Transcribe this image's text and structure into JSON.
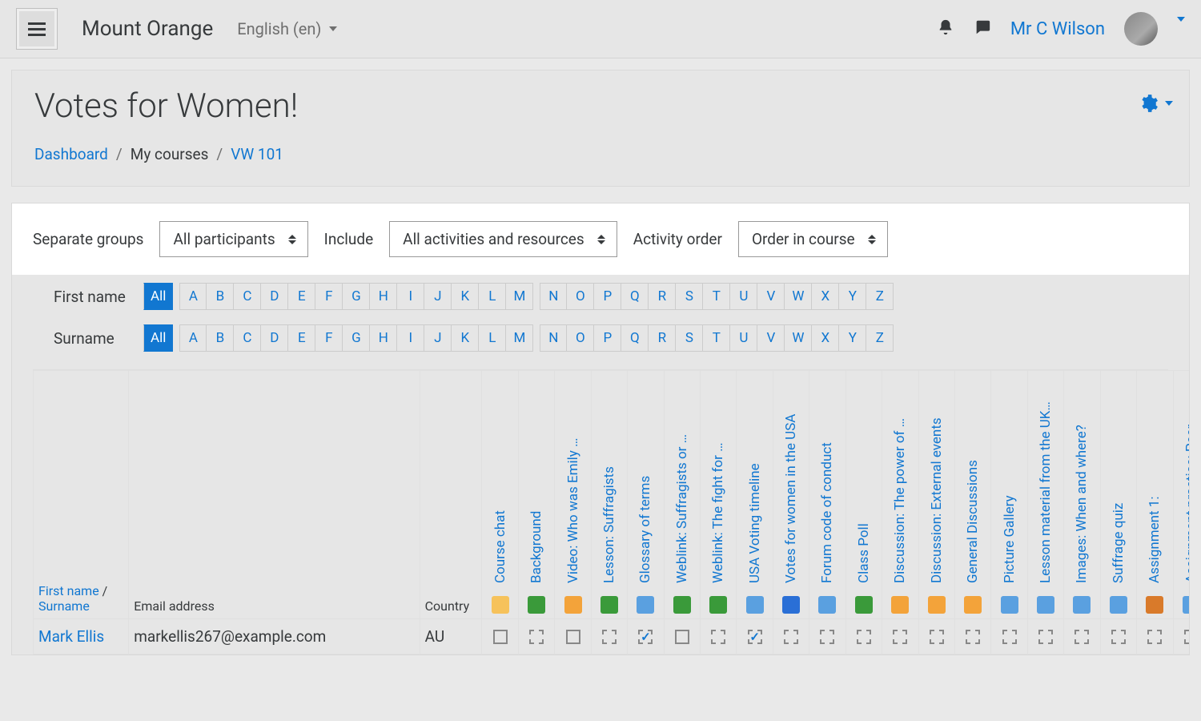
{
  "navbar": {
    "brand": "Mount Orange",
    "language": "English (en)",
    "user_name": "Mr C Wilson"
  },
  "header": {
    "title": "Votes for Women!",
    "breadcrumb": {
      "dashboard": "Dashboard",
      "mycourses": "My courses",
      "course_short": "VW 101"
    }
  },
  "filters": {
    "groups_label": "Separate groups",
    "groups_value": "All participants",
    "include_label": "Include",
    "include_value": "All activities and resources",
    "order_label": "Activity order",
    "order_value": "Order in course"
  },
  "letter_filter": {
    "firstname_label": "First name",
    "surname_label": "Surname",
    "all": "All",
    "letters": [
      "A",
      "B",
      "C",
      "D",
      "E",
      "F",
      "G",
      "H",
      "I",
      "J",
      "K",
      "L",
      "M",
      "N",
      "O",
      "P",
      "Q",
      "R",
      "S",
      "T",
      "U",
      "V",
      "W",
      "X",
      "Y",
      "Z"
    ]
  },
  "table": {
    "name_header_first": "First name",
    "name_header_surname": "Surname",
    "email_header": "Email address",
    "country_header": "Country",
    "activities": [
      "Course chat",
      "Background",
      "Video: Who was Emily …",
      "Lesson: Suffragists",
      "Glossary of terms",
      "Weblink: Suffragists or …",
      "Weblink: The fight for …",
      "USA Voting timeline",
      "Votes for women in the USA",
      "Forum code of conduct",
      "Class Poll",
      "Discussion: The power of …",
      "Discussion: External events",
      "General Discussions",
      "Picture Gallery",
      "Lesson material from the UK…",
      "Images: When and where?",
      "Suffrage quiz",
      "Assignment 1:",
      "Assignment practice: Peer …"
    ],
    "row": {
      "name": "Mark Ellis",
      "email": "markellis267@example.com",
      "country": "AU",
      "completion": [
        {
          "t": "solid"
        },
        {
          "t": "dash"
        },
        {
          "t": "solid"
        },
        {
          "t": "dash"
        },
        {
          "t": "dash",
          "done": true
        },
        {
          "t": "solid"
        },
        {
          "t": "dash"
        },
        {
          "t": "dash",
          "done": true
        },
        {
          "t": "dash"
        },
        {
          "t": "dash"
        },
        {
          "t": "dash"
        },
        {
          "t": "dash"
        },
        {
          "t": "dash"
        },
        {
          "t": "dash"
        },
        {
          "t": "dash"
        },
        {
          "t": "dash"
        },
        {
          "t": "dash"
        },
        {
          "t": "dash"
        },
        {
          "t": "dash"
        },
        {
          "t": "dash"
        }
      ]
    }
  }
}
